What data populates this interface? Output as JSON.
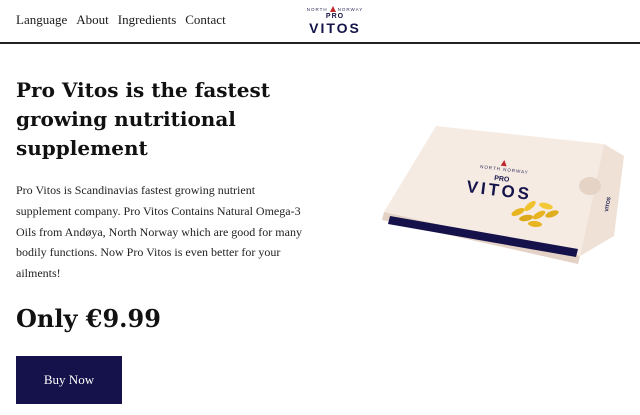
{
  "nav": {
    "links": [
      "Language",
      "About",
      "Ingredients",
      "Contact"
    ]
  },
  "logo": {
    "sub": "NORTH NORWAY",
    "pro": "PRO",
    "name": "VITOS"
  },
  "hero": {
    "title": "Pro Vitos is the fastest growing nutritional supplement",
    "body": "Pro Vitos is Scandinavias fastest growing nutrient supplement company. Pro Vitos Contains Natural Omega-3 Oils from Andøya, North Norway which are good for many bodily functions. Now Pro Vitos is even better for your ailments!",
    "price": "Only €9.99",
    "button_label": "Buy Now"
  },
  "product": {
    "sub": "NORTH NORWAY",
    "pro": "PRO",
    "name": "VITOS",
    "side_label": "VITOS"
  },
  "colors": {
    "brand_navy": "#15114a",
    "logo_red": "#c0282d",
    "box_cream": "#f3e6dc",
    "capsule_gold": "#e8b420"
  }
}
